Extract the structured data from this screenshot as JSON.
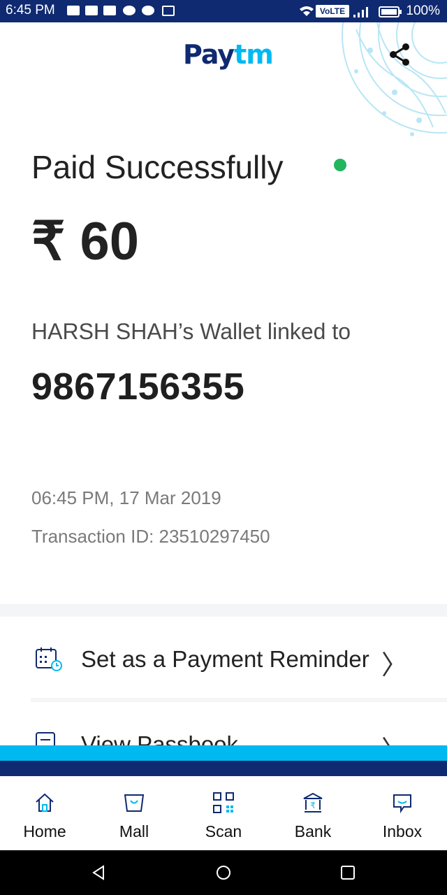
{
  "status_bar": {
    "time": "6:45 PM",
    "network_badge": "VoLTE",
    "battery_pct": "100%"
  },
  "header": {
    "logo_part1": "Pay",
    "logo_part2": "tm",
    "share_icon": "share-icon"
  },
  "receipt": {
    "title": "Paid Successfully",
    "amount": "₹ 60",
    "wallet_text": "HARSH SHAH’s Wallet linked to",
    "phone": "9867156355",
    "datetime": "06:45 PM, 17 Mar 2019",
    "transaction_id": "Transaction ID: 23510297450"
  },
  "actions": [
    {
      "label": "Set as a Payment Reminder",
      "icon": "calendar-clock-icon"
    },
    {
      "label": "View Passbook",
      "icon": "passbook-icon"
    }
  ],
  "bottom_nav": [
    {
      "label": "Home",
      "icon": "home-icon"
    },
    {
      "label": "Mall",
      "icon": "mall-icon"
    },
    {
      "label": "Scan",
      "icon": "qr-scan-icon"
    },
    {
      "label": "Bank",
      "icon": "bank-icon"
    },
    {
      "label": "Inbox",
      "icon": "inbox-icon"
    }
  ],
  "colors": {
    "navy": "#0f2a70",
    "cyan": "#00b9f1",
    "success": "#21b55e"
  }
}
